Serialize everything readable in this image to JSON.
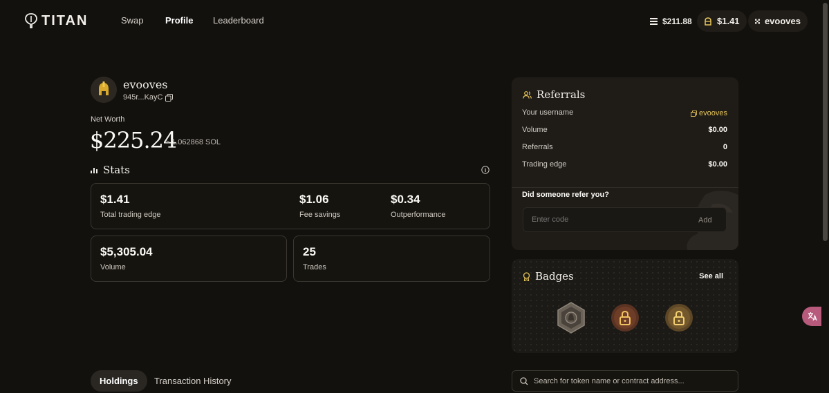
{
  "header": {
    "logo_text": "TITAN",
    "nav": [
      {
        "label": "Swap",
        "active": false
      },
      {
        "label": "Profile",
        "active": true
      },
      {
        "label": "Leaderboard",
        "active": false
      }
    ],
    "balance": "$211.88",
    "trading_edge": "$1.41",
    "user": "evooves"
  },
  "profile": {
    "username": "evooves",
    "address": "945r...KayC",
    "net_worth_label": "Net Worth",
    "net_worth": "$225.24",
    "net_worth_sol": "≈ 1.062868 SOL"
  },
  "stats": {
    "title": "Stats",
    "trading_edge": {
      "value": "$1.41",
      "label": "Total trading edge"
    },
    "fee_savings": {
      "value": "$1.06",
      "label": "Fee savings"
    },
    "outperformance": {
      "value": "$0.34",
      "label": "Outperformance"
    },
    "volume": {
      "value": "$5,305.04",
      "label": "Volume"
    },
    "trades": {
      "value": "25",
      "label": "Trades"
    }
  },
  "referrals": {
    "title": "Referrals",
    "rows": [
      {
        "key": "Your username",
        "value": "evooves"
      },
      {
        "key": "Volume",
        "value": "$0.00"
      },
      {
        "key": "Referrals",
        "value": "0"
      },
      {
        "key": "Trading edge",
        "value": "$0.00"
      }
    ],
    "question": "Did someone refer you?",
    "input_placeholder": "Enter code",
    "add_label": "Add"
  },
  "badges": {
    "title": "Badges",
    "see_all": "See all"
  },
  "tabs": [
    {
      "label": "Holdings",
      "active": true
    },
    {
      "label": "Transaction History",
      "active": false
    }
  ],
  "search": {
    "placeholder": "Search for token name or contract address..."
  },
  "colors": {
    "background": "#13110e",
    "panel": "#1f1c18",
    "accent_gold": "#e8c65a"
  }
}
